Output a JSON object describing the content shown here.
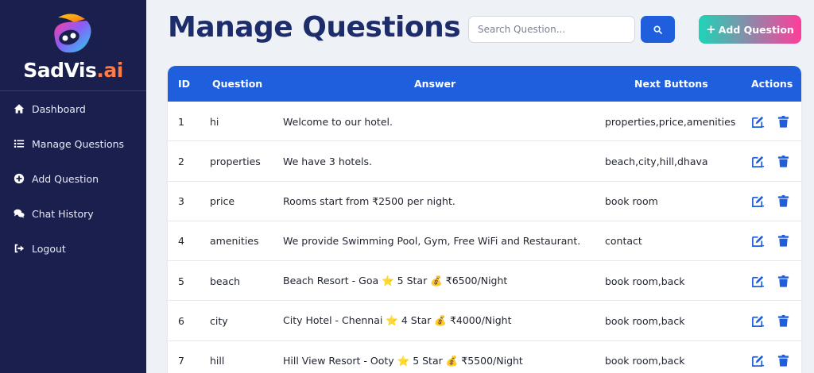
{
  "brand": {
    "name_main": "SadVis",
    "name_suffix": ".ai"
  },
  "sidebar": {
    "items": [
      {
        "label": "Dashboard",
        "icon": "home-icon"
      },
      {
        "label": "Manage Questions",
        "icon": "list-icon"
      },
      {
        "label": "Add Question",
        "icon": "plus-circle-icon"
      },
      {
        "label": "Chat History",
        "icon": "chat-icon"
      },
      {
        "label": "Logout",
        "icon": "logout-icon"
      }
    ]
  },
  "header": {
    "title": "Manage Questions",
    "search_placeholder": "Search Question...",
    "add_button_label": "Add Question"
  },
  "table": {
    "columns": [
      "ID",
      "Question",
      "Answer",
      "Next Buttons",
      "Actions"
    ],
    "rows": [
      {
        "id": "1",
        "question": "hi",
        "answer": "Welcome to our hotel.",
        "next": "properties,price,amenities"
      },
      {
        "id": "2",
        "question": "properties",
        "answer": "We have 3 hotels.",
        "next": "beach,city,hill,dhava"
      },
      {
        "id": "3",
        "question": "price",
        "answer": "Rooms start from ₹2500 per night.",
        "next": "book room"
      },
      {
        "id": "4",
        "question": "amenities",
        "answer": "We provide Swimming Pool, Gym, Free WiFi and Restaurant.",
        "next": "contact"
      },
      {
        "id": "5",
        "question": "beach",
        "answer": "Beach Resort - Goa ⭐ 5 Star 💰 ₹6500/Night",
        "next": "book room,back"
      },
      {
        "id": "6",
        "question": "city",
        "answer": "City Hotel - Chennai ⭐ 4 Star 💰 ₹4000/Night",
        "next": "book room,back"
      },
      {
        "id": "7",
        "question": "hill",
        "answer": "Hill View Resort - Ooty ⭐ 5 Star 💰 ₹5500/Night",
        "next": "book room,back"
      }
    ]
  },
  "colors": {
    "sidebar_bg": "#1b1f4e",
    "primary": "#1f5edc",
    "title": "#1d2c6b",
    "gradient_start": "#1ed4b6",
    "gradient_end": "#ff3d9a",
    "delete": "#1f5edc"
  }
}
